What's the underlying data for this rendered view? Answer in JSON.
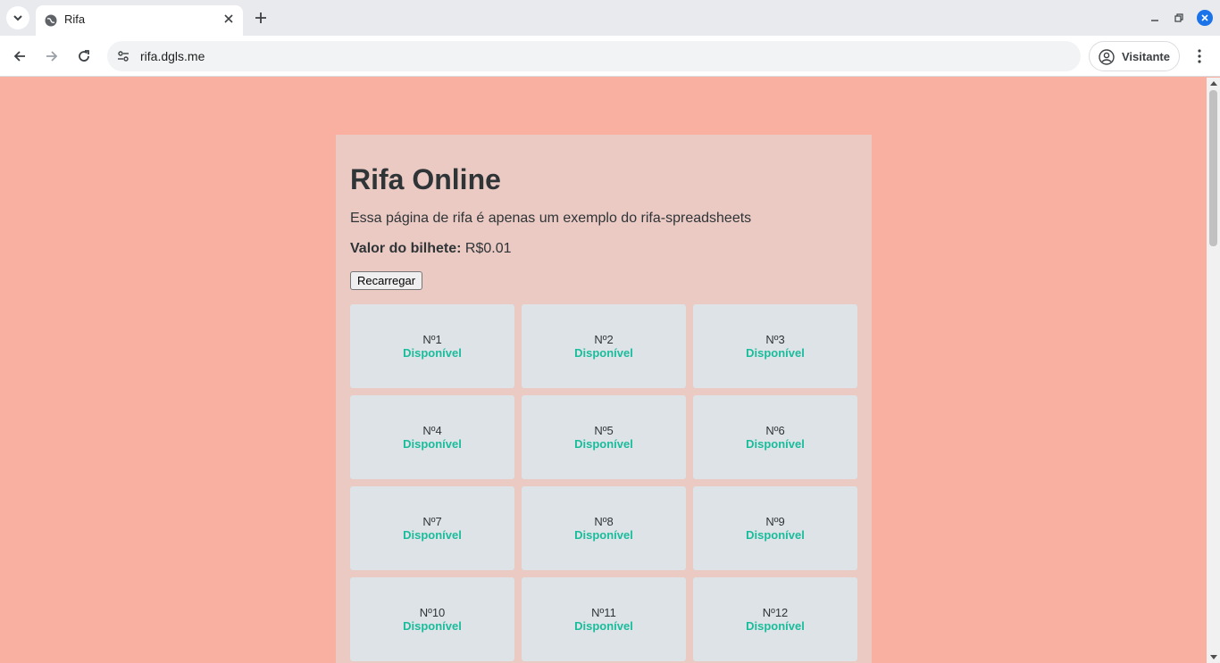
{
  "browser": {
    "tab_title": "Rifa",
    "url": "rifa.dgls.me",
    "profile_label": "Visitante"
  },
  "page": {
    "title": "Rifa Online",
    "description": "Essa página de rifa é apenas um exemplo do rifa-spreadsheets",
    "price_label": "Valor do bilhete:",
    "price_value": "R$0.01",
    "reload_label": "Recarregar",
    "status_color": "#1abc9c",
    "tickets": [
      {
        "number": "Nº1",
        "status": "Disponível"
      },
      {
        "number": "Nº2",
        "status": "Disponível"
      },
      {
        "number": "Nº3",
        "status": "Disponível"
      },
      {
        "number": "Nº4",
        "status": "Disponível"
      },
      {
        "number": "Nº5",
        "status": "Disponível"
      },
      {
        "number": "Nº6",
        "status": "Disponível"
      },
      {
        "number": "Nº7",
        "status": "Disponível"
      },
      {
        "number": "Nº8",
        "status": "Disponível"
      },
      {
        "number": "Nº9",
        "status": "Disponível"
      },
      {
        "number": "Nº10",
        "status": "Disponível"
      },
      {
        "number": "Nº11",
        "status": "Disponível"
      },
      {
        "number": "Nº12",
        "status": "Disponível"
      }
    ]
  }
}
